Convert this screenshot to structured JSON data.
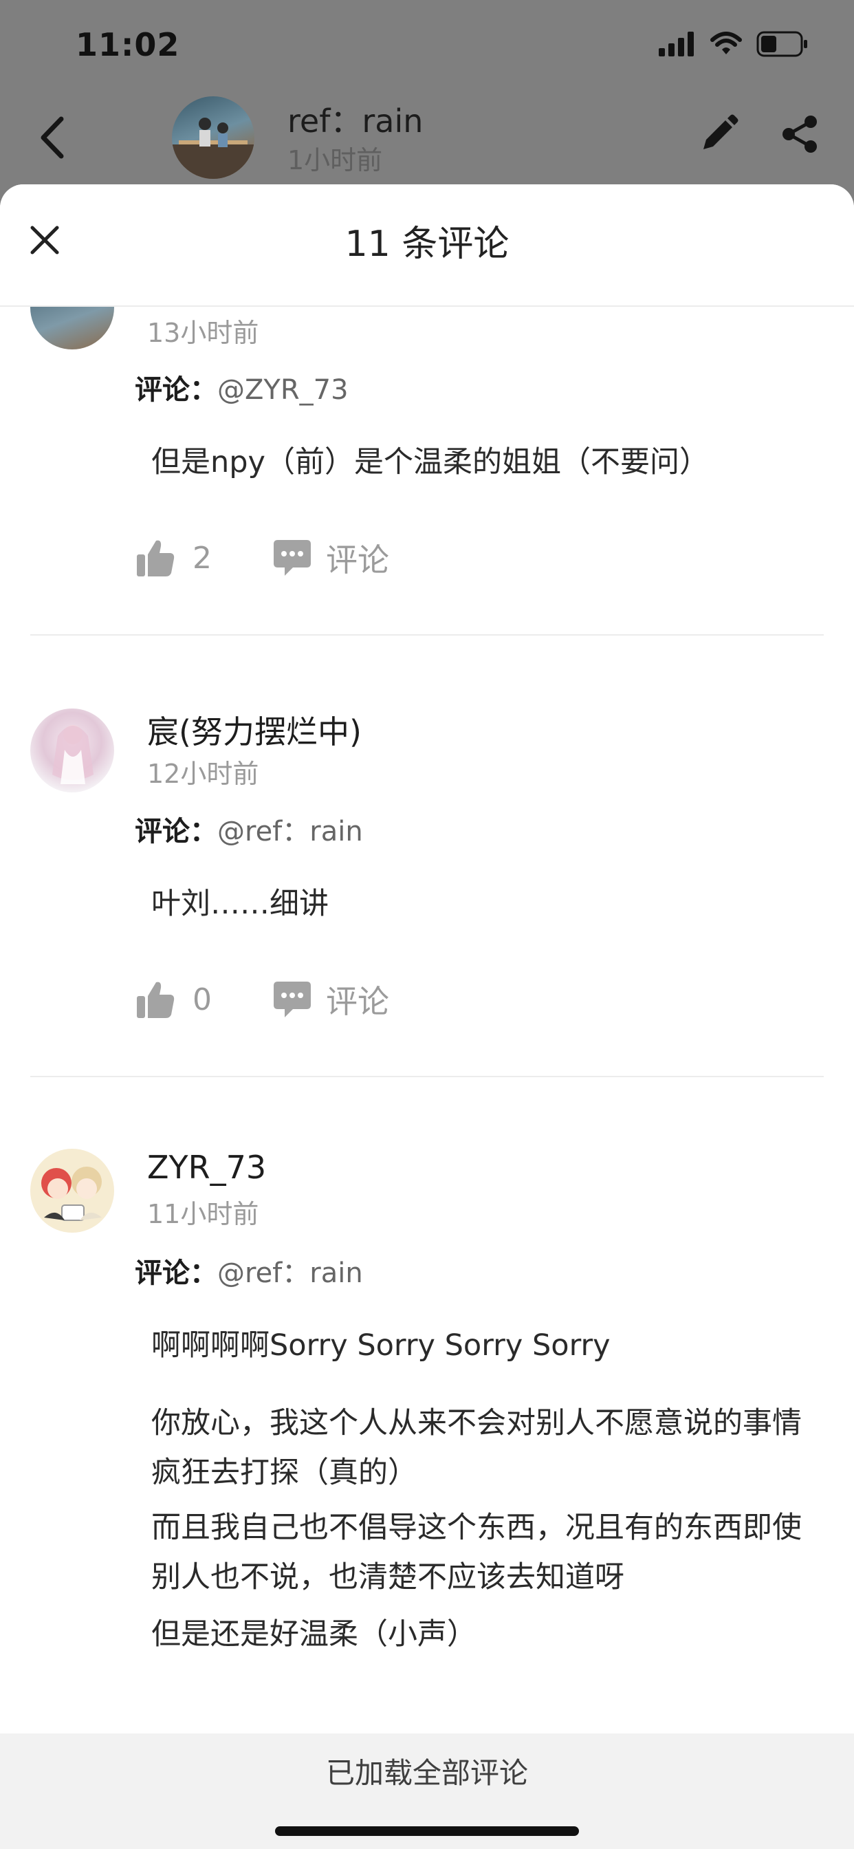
{
  "status_bar": {
    "time": "11:02"
  },
  "post": {
    "author": "ref：rain",
    "time": "1小时前"
  },
  "sheet": {
    "title": "11 条评论"
  },
  "comments": [
    {
      "time": "13小时前",
      "reply_label": "评论：",
      "reply_target": "@ZYR_73",
      "paragraphs": [
        "但是npy（前）是个温柔的姐姐（不要问）"
      ],
      "likes": "2",
      "comment_label": "评论"
    },
    {
      "username": "宸(努力摆烂中)",
      "time": "12小时前",
      "reply_label": "评论：",
      "reply_target": "@ref：rain",
      "paragraphs": [
        "叶刘……细讲"
      ],
      "likes": "0",
      "comment_label": "评论"
    },
    {
      "username": "ZYR_73",
      "time": "11小时前",
      "reply_label": "评论：",
      "reply_target": "@ref：rain",
      "paragraphs": [
        "啊啊啊啊Sorry Sorry Sorry Sorry",
        "你放心，我这个人从来不会对别人不愿意说的事情疯狂去打探（真的）",
        "而且我自己也不倡导这个东西，况且有的东西即使别人也不说，也清楚不应该去知道呀",
        "但是还是好温柔（小声）"
      ]
    }
  ],
  "footer": {
    "text": "已加载全部评论"
  },
  "colors": {
    "muted": "#9b9b9b",
    "overlay": "#7f7f7f",
    "footer_bg": "#f2f2f2"
  }
}
